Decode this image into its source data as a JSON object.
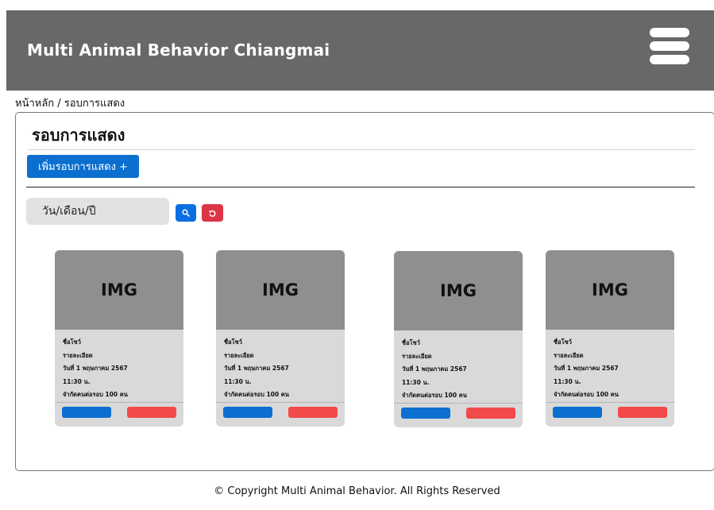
{
  "header": {
    "title": "Multi Animal Behavior Chiangmai",
    "menu_icon": "hamburger-menu-icon",
    "background": "#686868"
  },
  "breadcrumb": "หน้าหลัก / รอบการแสดง",
  "main": {
    "title": "รอบการแสดง",
    "add_button_label": "เพิ่มรอบการแสดง +",
    "date_filter": {
      "value": "วัน/เดือน/ปี"
    },
    "search_icon": "search-icon",
    "reset_icon": "refresh-icon"
  },
  "cards": [
    {
      "image_label": "IMG",
      "name": "ชื่อโชว์",
      "detail": "รายละเอียด",
      "date": "วันที่ 1 พฤษภาคม 2567",
      "time": "11:30 น.",
      "capacity": "จำกัดคนต่อรอบ 100 คน"
    },
    {
      "image_label": "IMG",
      "name": "ชื่อโชว์",
      "detail": "รายละเอียด",
      "date": "วันที่ 1 พฤษภาคม 2567",
      "time": "11:30 น.",
      "capacity": "จำกัดคนต่อรอบ 100 คน"
    },
    {
      "image_label": "IMG",
      "name": "ชื่อโชว์",
      "detail": "รายละเอียด",
      "date": "วันที่ 1 พฤษภาคม 2567",
      "time": "11:30 น.",
      "capacity": "จำกัดคนต่อรอบ 100 คน"
    },
    {
      "image_label": "IMG",
      "name": "ชื่อโชว์",
      "detail": "รายละเอียด",
      "date": "วันที่ 1 พฤษภาคม 2567",
      "time": "11:30 น.",
      "capacity": "จำกัดคนต่อรอบ 100 คน"
    }
  ],
  "colors": {
    "primary": "#0b6fd0",
    "danger": "#dc3545",
    "card_delete": "#f24a4a"
  },
  "footer": "© Copyright Multi Animal Behavior. All Rights Reserved"
}
